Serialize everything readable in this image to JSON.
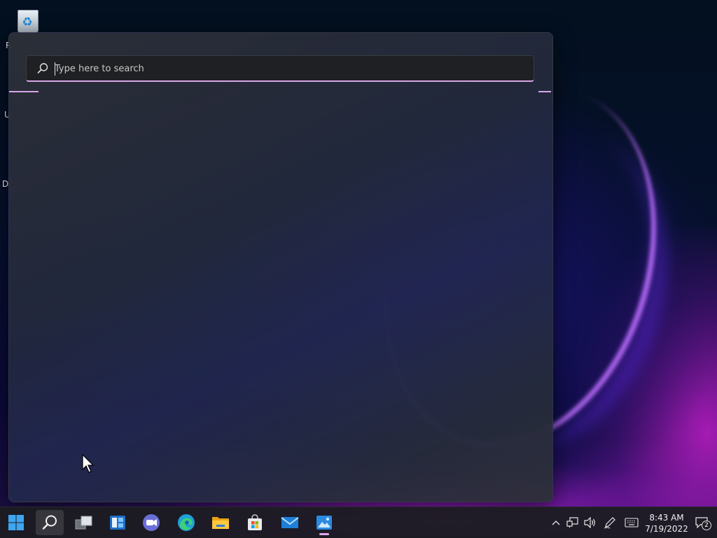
{
  "desktop": {
    "icon_labels_partial": [
      "R",
      "U",
      "D"
    ]
  },
  "search": {
    "placeholder": "Type here to search",
    "value": ""
  },
  "taskbar": {
    "items": [
      {
        "name": "start",
        "icon": "windows-logo-icon"
      },
      {
        "name": "search",
        "icon": "search-icon",
        "active": true
      },
      {
        "name": "task-view",
        "icon": "task-view-icon"
      },
      {
        "name": "widgets",
        "icon": "widgets-icon"
      },
      {
        "name": "chat",
        "icon": "teams-chat-icon"
      },
      {
        "name": "edge",
        "icon": "edge-browser-icon"
      },
      {
        "name": "file-explorer",
        "icon": "folder-icon"
      },
      {
        "name": "store",
        "icon": "store-icon"
      },
      {
        "name": "mail",
        "icon": "mail-icon"
      },
      {
        "name": "photos",
        "icon": "photos-icon",
        "running": true
      }
    ],
    "tray": {
      "icons": [
        "chevron-up-icon",
        "network-icon",
        "volume-icon",
        "pen-icon",
        "keyboard-icon"
      ],
      "time": "8:43 AM",
      "date": "7/19/2022",
      "notification_count": "2"
    }
  },
  "colors": {
    "accent": "#d8a6e8",
    "taskbar_bg": "#1c1c22"
  }
}
